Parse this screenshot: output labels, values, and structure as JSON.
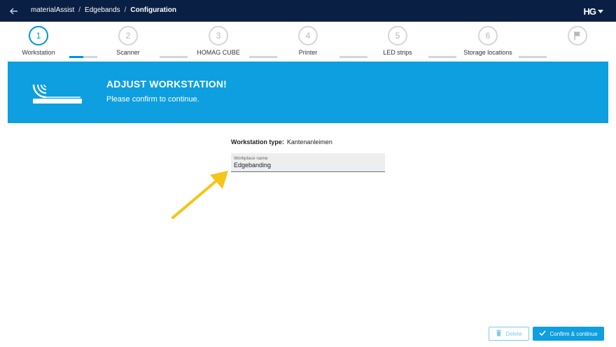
{
  "header": {
    "breadcrumbs": [
      "materialAssist",
      "Edgebands",
      "Configuration"
    ],
    "separator": "/",
    "logo_text": "HG"
  },
  "stepper": {
    "steps": [
      {
        "number": "1",
        "label": "Workstation",
        "state": "active"
      },
      {
        "number": "2",
        "label": "Scanner",
        "state": "inactive"
      },
      {
        "number": "3",
        "label": "HOMAG CUBE",
        "state": "inactive"
      },
      {
        "number": "4",
        "label": "Printer",
        "state": "inactive"
      },
      {
        "number": "5",
        "label": "LED strips",
        "state": "inactive"
      },
      {
        "number": "6",
        "label": "Storage locations",
        "state": "inactive"
      },
      {
        "number": "",
        "label": "",
        "state": "finish",
        "icon": "flag-icon"
      }
    ],
    "progress_first_connector": 0.5
  },
  "banner": {
    "title": "ADJUST WORKSTATION!",
    "subtitle": "Please confirm to continue.",
    "icon": "edgeband-roll-icon"
  },
  "form": {
    "type_label": "Workstation type:",
    "type_value": "Kantenanleimen",
    "name_label": "Workplace name",
    "name_value": "Edgebanding"
  },
  "actions": {
    "delete_label": "Delete",
    "confirm_label": "Confirm & continue"
  },
  "colors": {
    "topbar": "#0a1f44",
    "accent": "#0d9fdf",
    "annotation_arrow": "#f5c518"
  }
}
